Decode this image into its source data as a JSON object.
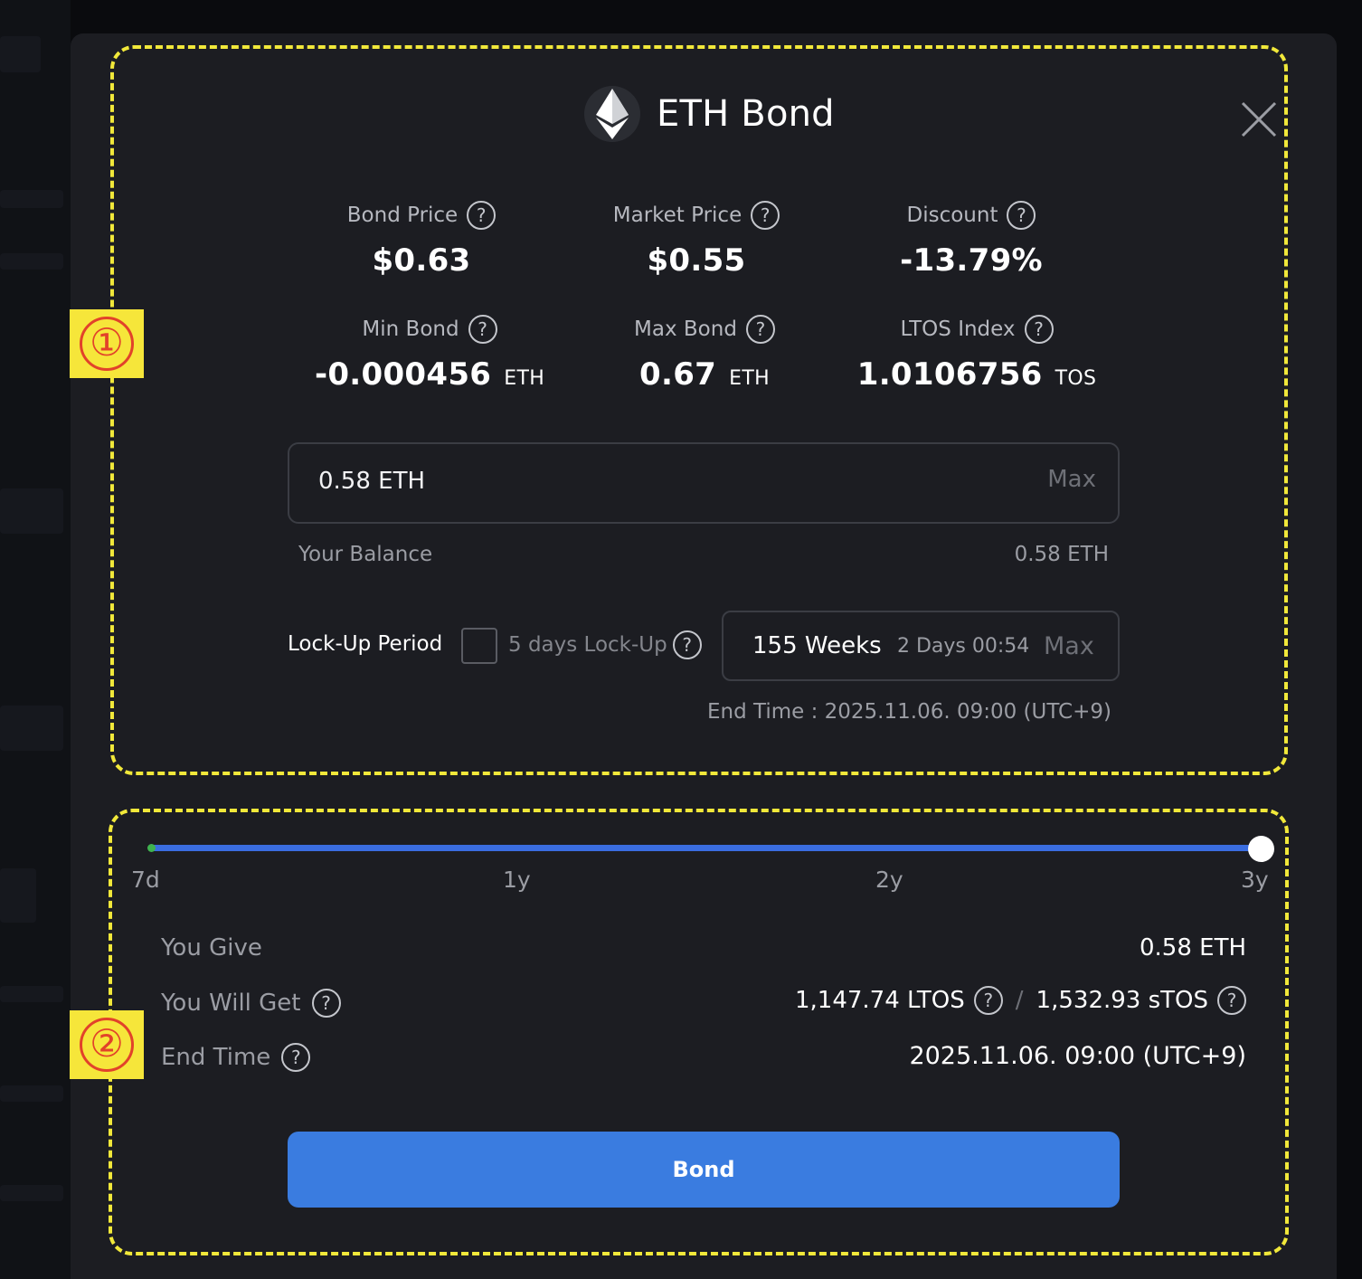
{
  "header": {
    "title": "ETH Bond"
  },
  "stats": [
    {
      "label": "Bond Price",
      "value": "$0.63",
      "unit": ""
    },
    {
      "label": "Market Price",
      "value": "$0.55",
      "unit": ""
    },
    {
      "label": "Discount",
      "value": "-13.79%",
      "unit": ""
    },
    {
      "label": "Min Bond",
      "value": "-0.000456",
      "unit": "ETH"
    },
    {
      "label": "Max Bond",
      "value": "0.67",
      "unit": "ETH"
    },
    {
      "label": "LTOS Index",
      "value": "1.0106756",
      "unit": "TOS"
    }
  ],
  "amount_input": {
    "value": "0.58  ETH",
    "max_label": "Max"
  },
  "balance": {
    "label": "Your Balance",
    "value": "0.58 ETH"
  },
  "lockup": {
    "label": "Lock-Up Period",
    "checkbox_checked": false,
    "days_label": "5 days Lock-Up",
    "weeks": "155 Weeks",
    "days_time": "2 Days 00:54",
    "max_label": "Max",
    "end_time": "End Time : 2025.11.06. 09:00 (UTC+9)"
  },
  "slider": {
    "ticks": [
      "7d",
      "1y",
      "2y",
      "3y"
    ],
    "value_fraction": 1.0
  },
  "summary": {
    "give_label": "You Give",
    "give_value": "0.58 ETH",
    "get_label": "You Will Get",
    "get_ltos": "1,147.74 LTOS",
    "get_sep": "/",
    "get_stos": "1,532.93 sTOS",
    "end_label": "End Time",
    "end_value": "2025.11.06. 09:00 (UTC+9)"
  },
  "bond_button": {
    "label": "Bond"
  },
  "annotations": {
    "marker_1": "①",
    "marker_2": "②"
  },
  "colors": {
    "accent": "#3a7ce0",
    "annotation": "#f1e83a",
    "modal_bg": "#1c1d22"
  }
}
